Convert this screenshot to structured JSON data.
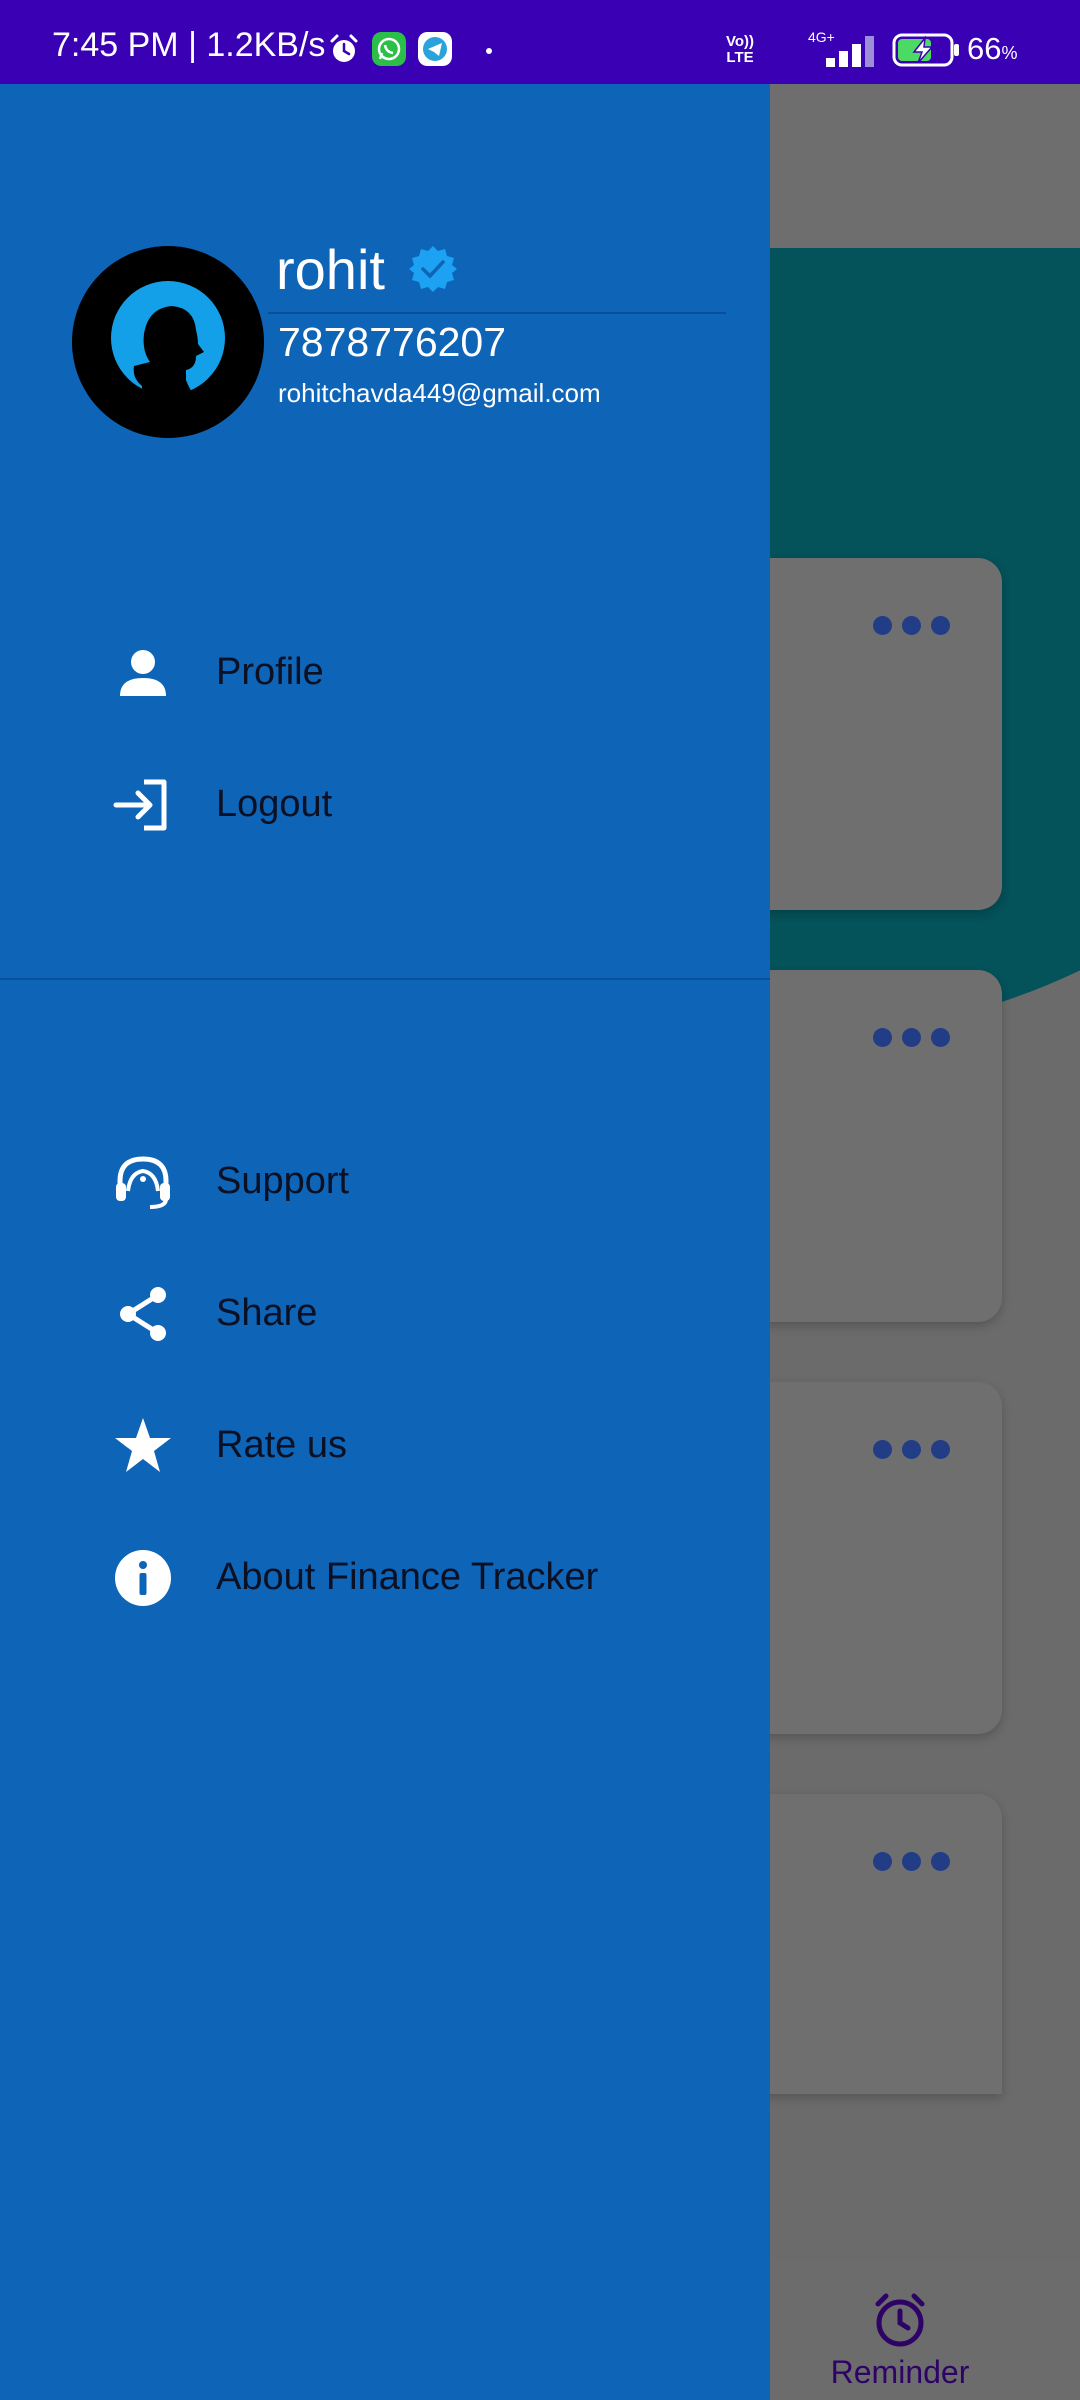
{
  "status_bar": {
    "time": "7:45 PM | 1.2KB/s",
    "network_label_top": "Vo))",
    "network_label_bottom": "LTE",
    "signal_label": "4G+",
    "battery_percent": "66",
    "percent_sign": "%",
    "battery_level": 0.66,
    "icons": [
      "alarm-icon",
      "whatsapp-icon",
      "telegram-icon",
      "signal-icon",
      "battery-charging-icon"
    ]
  },
  "drawer": {
    "header": {
      "name": "rohit",
      "phone": "7878776207",
      "email": "rohitchavda449@gmail.com",
      "verified_color": "#1da1f2"
    },
    "primary_menu": [
      {
        "label": "Profile",
        "icon": "person-icon"
      },
      {
        "label": "Logout",
        "icon": "logout-icon"
      }
    ],
    "secondary_menu": [
      {
        "label": "Support",
        "icon": "support-headset-icon"
      },
      {
        "label": "Share",
        "icon": "share-icon"
      },
      {
        "label": "Rate us",
        "icon": "star-icon"
      },
      {
        "label": "About Finance Tracker",
        "icon": "info-icon"
      }
    ],
    "background_color": "#0e64b7"
  },
  "background_app": {
    "bottom_nav_visible_label": "Reminder",
    "accent_color": "#04525a"
  }
}
